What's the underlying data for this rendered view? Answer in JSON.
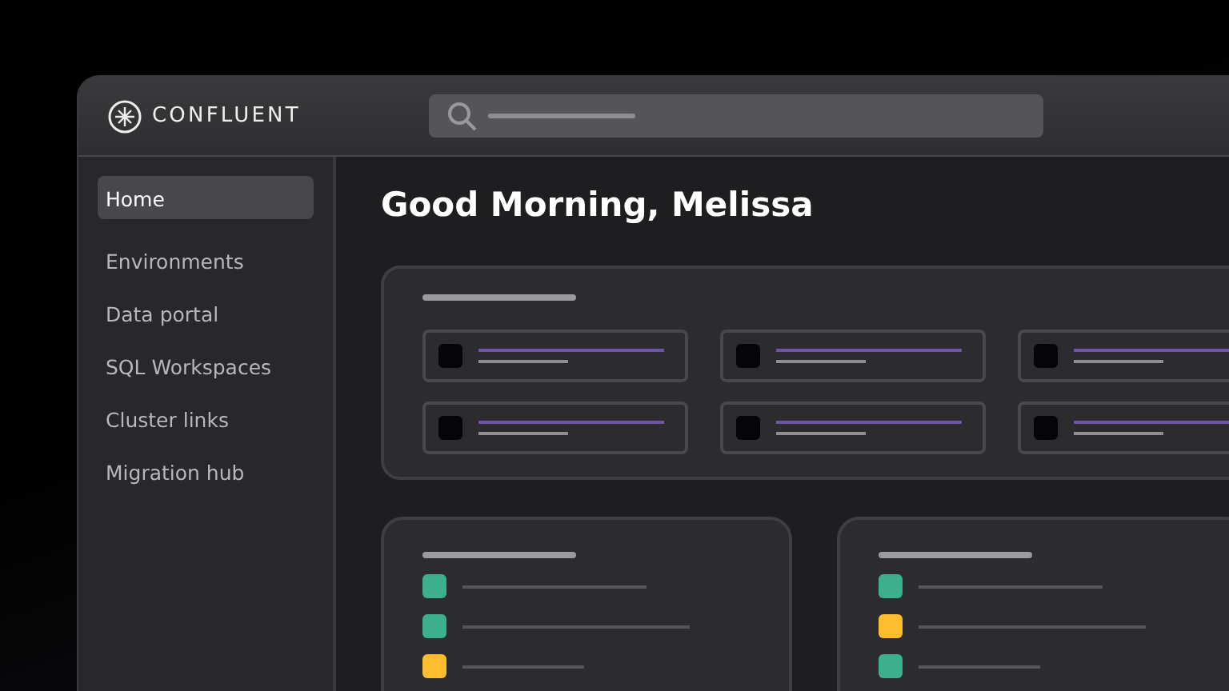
{
  "brand": {
    "name": "CONFLUENT"
  },
  "sidebar": {
    "items": [
      {
        "label": "Home",
        "selected": true
      },
      {
        "label": "Environments",
        "selected": false
      },
      {
        "label": "Data portal",
        "selected": false
      },
      {
        "label": "SQL Workspaces",
        "selected": false
      },
      {
        "label": "Cluster links",
        "selected": false
      },
      {
        "label": "Migration hub",
        "selected": false
      }
    ]
  },
  "greeting": "Good Morning, Melissa",
  "status_panels": [
    {
      "items": [
        {
          "color": "#3bb08a"
        },
        {
          "color": "#3bb08a"
        },
        {
          "color": "#fdbd2d"
        }
      ]
    },
    {
      "items": [
        {
          "color": "#3bb08a"
        },
        {
          "color": "#fdbd2d"
        },
        {
          "color": "#3bb08a"
        }
      ]
    }
  ]
}
